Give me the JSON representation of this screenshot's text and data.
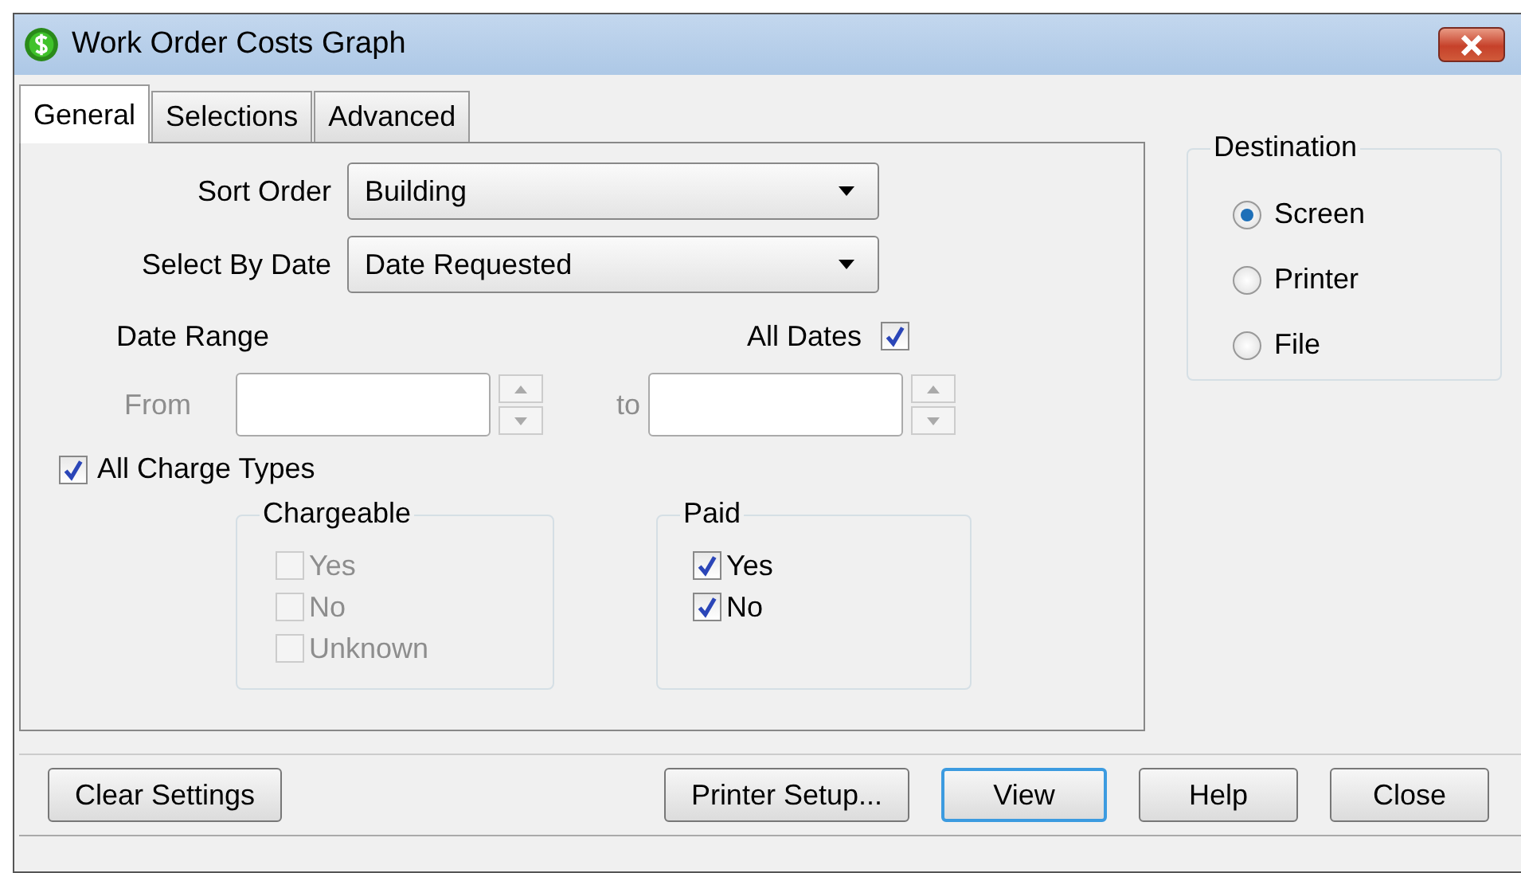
{
  "window": {
    "title": "Work Order Costs Graph"
  },
  "tabs": [
    {
      "label": "General",
      "selected": true
    },
    {
      "label": "Selections",
      "selected": false
    },
    {
      "label": "Advanced",
      "selected": false
    }
  ],
  "sort_order": {
    "label": "Sort Order",
    "value": "Building"
  },
  "select_by_date": {
    "label": "Select By Date",
    "value": "Date Requested"
  },
  "date_range": {
    "label": "Date Range",
    "all_dates": {
      "label": "All Dates",
      "checked": true
    },
    "from": {
      "label": "From",
      "disabled": true
    },
    "to": {
      "label": "to",
      "disabled": true
    }
  },
  "all_charge_types": {
    "label": "All Charge Types",
    "checked": true
  },
  "chargeable": {
    "title": "Chargeable",
    "options": [
      {
        "label": "Yes",
        "checked": false,
        "disabled": true
      },
      {
        "label": "No",
        "checked": false,
        "disabled": true
      },
      {
        "label": "Unknown",
        "checked": false,
        "disabled": true
      }
    ]
  },
  "paid": {
    "title": "Paid",
    "options": [
      {
        "label": "Yes",
        "checked": true,
        "disabled": false
      },
      {
        "label": "No",
        "checked": true,
        "disabled": false
      }
    ]
  },
  "destination": {
    "title": "Destination",
    "options": [
      {
        "label": "Screen",
        "selected": true
      },
      {
        "label": "Printer",
        "selected": false
      },
      {
        "label": "File",
        "selected": false
      }
    ]
  },
  "buttons": [
    {
      "label": "Clear Settings",
      "default": false
    },
    {
      "label": "Printer Setup...",
      "default": false
    },
    {
      "label": "View",
      "default": true
    },
    {
      "label": "Help",
      "default": false
    },
    {
      "label": "Close",
      "default": false
    }
  ]
}
